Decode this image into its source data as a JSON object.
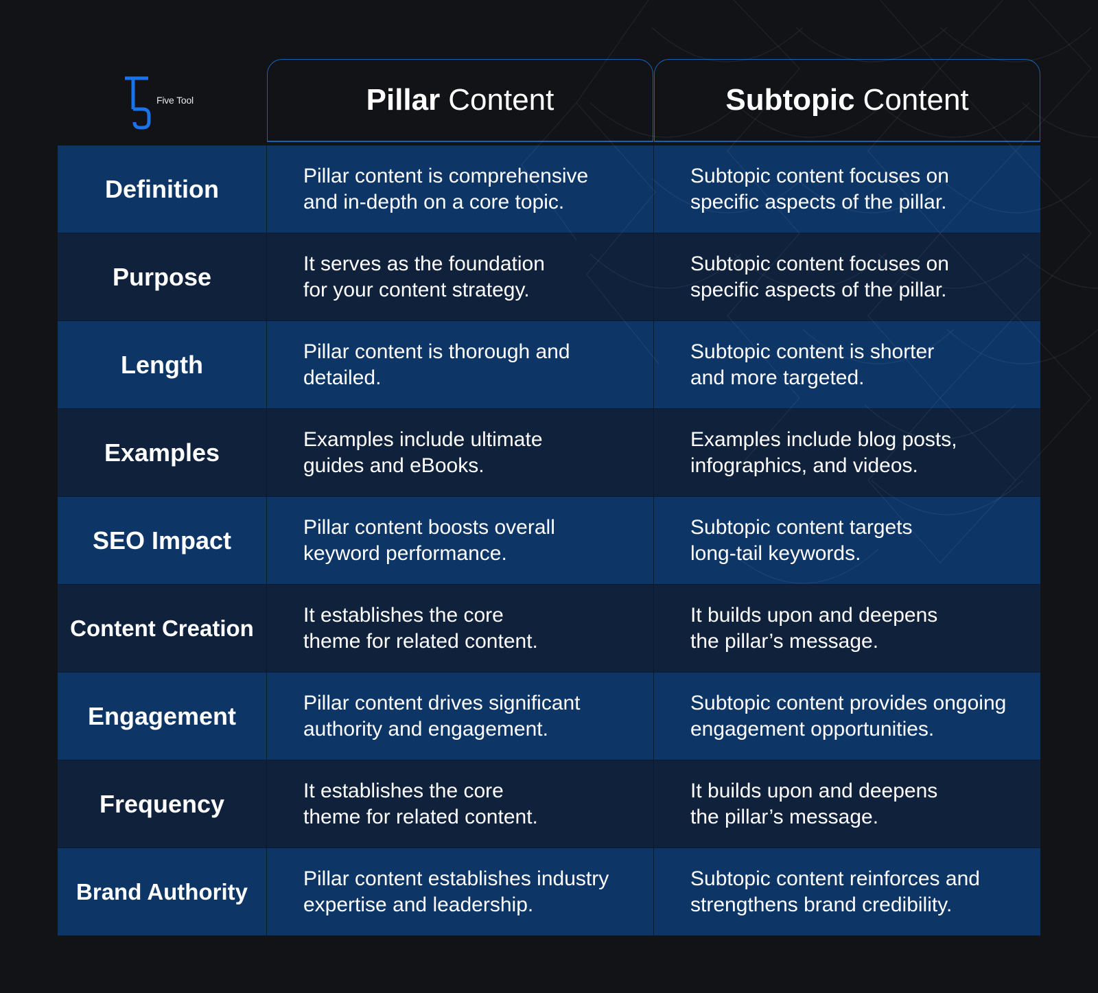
{
  "brand": {
    "logo_icon": "five-tool-t5-logo",
    "name": "Five Tool",
    "accent_color": "#1a73e8"
  },
  "columns": [
    {
      "bold": "Pillar",
      "rest": "Content"
    },
    {
      "bold": "Subtopic",
      "rest": "Content"
    }
  ],
  "colors": {
    "background": "#121317",
    "row_primary": "#0d3566",
    "row_secondary": "#10213b",
    "header_border": "#1d5fb4",
    "text": "#ffffff"
  },
  "rows": [
    {
      "label": "Definition",
      "pillar": "Pillar content is comprehensive\nand in-depth on a core topic.",
      "subtopic": "Subtopic content focuses on\nspecific aspects of the pillar."
    },
    {
      "label": "Purpose",
      "pillar": "It serves as the foundation\nfor your content strategy.",
      "subtopic": "Subtopic content focuses on\nspecific aspects of the pillar."
    },
    {
      "label": "Length",
      "pillar": "Pillar content is thorough and\ndetailed.",
      "subtopic": "Subtopic content is shorter\nand more targeted."
    },
    {
      "label": "Examples",
      "pillar": "Examples include ultimate\nguides and eBooks.",
      "subtopic": "Examples include blog posts,\ninfographics, and videos."
    },
    {
      "label": "SEO Impact",
      "pillar": "Pillar content boosts overall\nkeyword performance.",
      "subtopic": "Subtopic content targets\nlong-tail keywords."
    },
    {
      "label": "Content Creation",
      "pillar": "It establishes the core\ntheme for related content.",
      "subtopic": "It builds upon and deepens\nthe pillar’s message."
    },
    {
      "label": "Engagement",
      "pillar": "Pillar content drives significant\nauthority and engagement.",
      "subtopic": "Subtopic content provides ongoing\nengagement opportunities."
    },
    {
      "label": "Frequency",
      "pillar": "It establishes the core\ntheme for related content.",
      "subtopic": "It builds upon and deepens\nthe pillar’s message."
    },
    {
      "label": "Brand Authority",
      "pillar": "Pillar content establishes industry\nexpertise and leadership.",
      "subtopic": "Subtopic content reinforces and\nstrengthens brand credibility."
    }
  ]
}
